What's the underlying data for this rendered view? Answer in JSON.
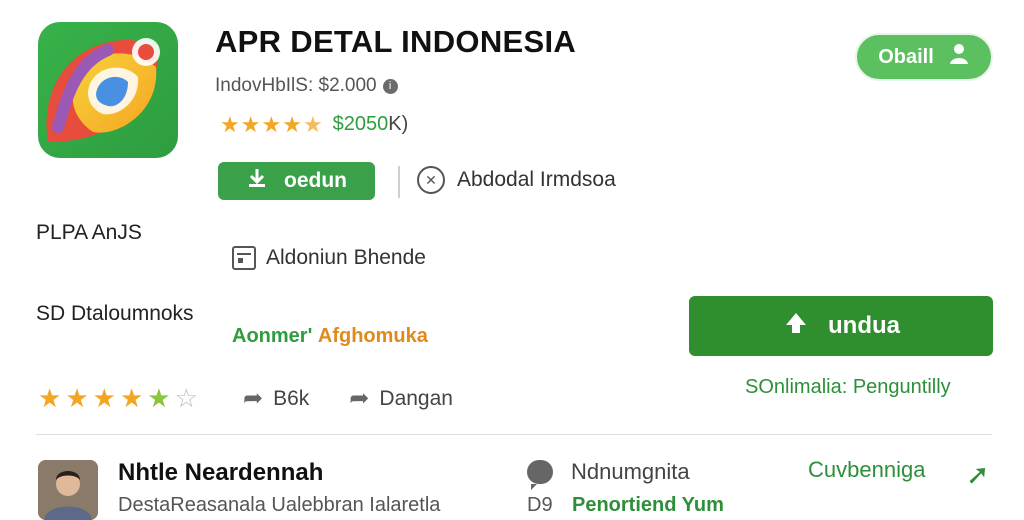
{
  "app": {
    "title": "APR DETAL  INDONESIA",
    "subtitle": "IndovHbIlS: $2.000",
    "rating_value": "$2050",
    "rating_suffix": "K)",
    "icon": "app-logo-icon"
  },
  "header": {
    "pill_button_label": "Obaill",
    "pill_button_icon": "person-icon"
  },
  "actions": {
    "small_download_label": "oedun",
    "small_download_icon": "download-icon",
    "spam_label": "Abdodal Irmdsoa",
    "spam_icon": "shield-icon"
  },
  "sections": {
    "plan_label": "PLPA AnJS",
    "ads_label": "Aldoniun Bhende",
    "ads_icon": "calendar-icon",
    "details_label": "SD Dtaloumnoks",
    "category_primary": "Aonmer'",
    "category_secondary": "Afghomuka"
  },
  "main_button": {
    "label": "undua",
    "icon": "download-icon"
  },
  "stats": {
    "rating_stars": 4,
    "share_count": "B6k",
    "share_icon": "share-icon",
    "channel_label": "Dangan",
    "channel_icon": "share-icon",
    "compat_label": "SOnlimalia: Penguntilly"
  },
  "review": {
    "reviewer": "Nhtle Neardennah",
    "text": "DestaReasanala Ualebbran Ialaretla",
    "chat_label": "Ndnumgnita",
    "chat_icon": "chat-icon",
    "count": "D9",
    "reply": "Penortiend Yum",
    "link_label": "Cuvbenniga",
    "link_icon": "arrow-right-icon"
  },
  "colors": {
    "accent_green": "#2e8f3a",
    "button_green": "#2f8f2f",
    "pill_green": "#5cbf60",
    "star_orange": "#f2a623"
  }
}
